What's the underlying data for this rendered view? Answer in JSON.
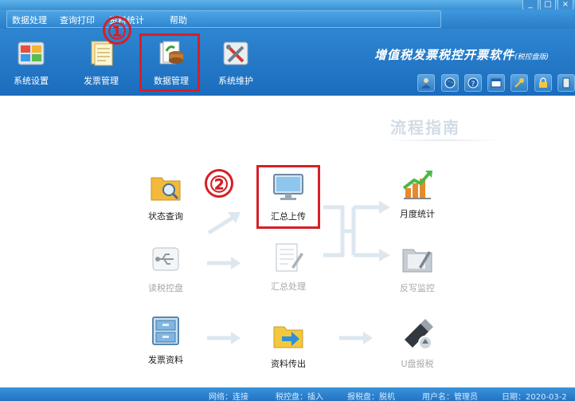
{
  "window": {
    "minimize_label": "_",
    "maximize_label": "□",
    "close_label": "×"
  },
  "menu": {
    "items": [
      {
        "label": "数据处理"
      },
      {
        "label": "查询打印"
      },
      {
        "label": "资料统计"
      },
      {
        "label": "帮助"
      }
    ]
  },
  "toolbar": {
    "items": [
      {
        "label": "系统设置",
        "icon": "settings-panel-icon"
      },
      {
        "label": "发票管理",
        "icon": "invoice-icon"
      },
      {
        "label": "数据管理",
        "icon": "data-management-icon"
      },
      {
        "label": "系统维护",
        "icon": "tools-icon"
      }
    ],
    "brand": "增值税发票税控开票软件",
    "brand_sub": "(税控盘版)",
    "small_buttons": [
      "user-icon",
      "globe-icon",
      "help-icon",
      "window-icon",
      "key-icon",
      "lock-icon",
      "phone-icon"
    ]
  },
  "annotations": {
    "marker_1": "①",
    "marker_2": "②",
    "color": "#d61f26"
  },
  "guide": {
    "title": "流程指南",
    "nodes": {
      "status_query": {
        "label": "状态查询",
        "icon": "folder-search-icon"
      },
      "summary_upload": {
        "label": "汇总上传",
        "icon": "monitor-icon"
      },
      "monthly_stats": {
        "label": "月度统计",
        "icon": "bar-chart-icon"
      },
      "read_tax_disk": {
        "label": "读税控盘",
        "icon": "usb-icon"
      },
      "summary_process": {
        "label": "汇总处理",
        "icon": "document-edit-icon"
      },
      "write_back": {
        "label": "反写监控",
        "icon": "folder-write-icon"
      },
      "invoice_data": {
        "label": "发票资料",
        "icon": "cabinet-icon"
      },
      "data_export": {
        "label": "资料传出",
        "icon": "folder-export-icon"
      },
      "usb_report": {
        "label": "U盘报税",
        "icon": "usb-drive-icon"
      }
    }
  },
  "status": {
    "network": "网络：连接",
    "disk": "税控盘：插入",
    "report_disk": "报税盘：脱机",
    "user": "用户名：管理员",
    "date": "日期：2020-03-2"
  },
  "colors": {
    "header_blue": "#2a7dc7",
    "toolbar_blue": "#1b6cbd",
    "highlight_red": "#d61f26"
  }
}
